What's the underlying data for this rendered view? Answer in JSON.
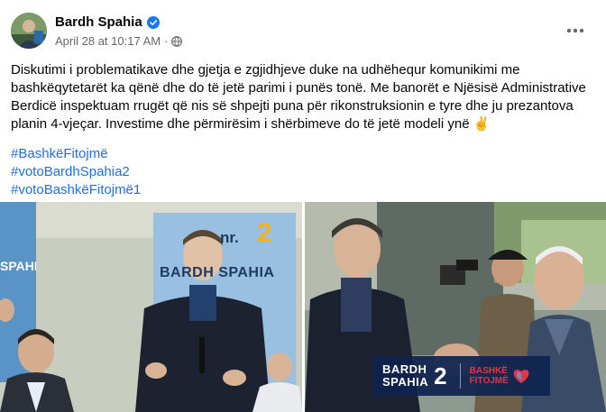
{
  "author": {
    "name": "Bardh Spahia",
    "verified_icon": "verified-badge-icon",
    "avatar_icon": "avatar"
  },
  "meta": {
    "date": "April 28 at 10:17 AM",
    "separator": "·",
    "audience_icon": "globe-icon"
  },
  "menu": {
    "icon": "more-options-icon",
    "label": "•••"
  },
  "post": {
    "text": "Diskutimi i problematikave dhe gjetja e zgjidhjeve duke na udhëhequr komunikimi me bashkëqytetarët ka qënë dhe do të jetë parimi i punës tonë. Me banorët e Njësisë Administrative Berdicë inspektuam rrugët që nis së shpejti puna për rikonstruksionin e tyre dhe ju prezantova planin 4-vjeçar. Investime dhe përmirësim i shërbimeve do të jetë modeli ynë ✌️",
    "hashtags": [
      "#BashkëFitojmë",
      "#votoBardhSpahia2",
      "#votoBashkëFitojmë1"
    ]
  },
  "photos": {
    "left": {
      "banner_top": "nr.",
      "banner_number": "2",
      "banner_name": "BARDH SPAHIA",
      "side_banner": "SPAHIA"
    },
    "right": {
      "logo_name_line1": "BARDH",
      "logo_name_line2": "SPAHIA",
      "logo_number": "2",
      "logo_slogan_line1": "BASHKË",
      "logo_slogan_line2": "FITOJMË"
    }
  },
  "colors": {
    "hashtag": "#216fdb",
    "verified": "#1877f2",
    "meta_text": "#65676b"
  }
}
